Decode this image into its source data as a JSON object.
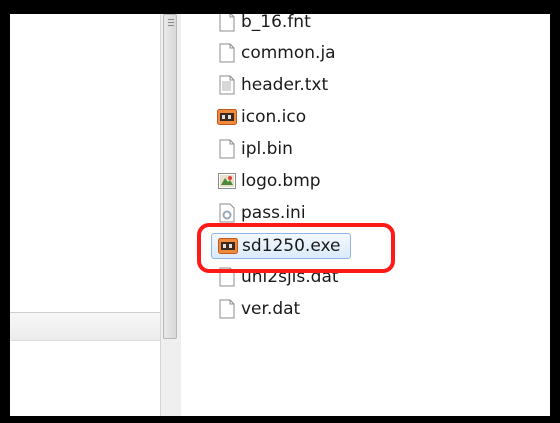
{
  "files": [
    {
      "name": "b_16.fnt",
      "icon": "file-icon"
    },
    {
      "name": "common.ja",
      "icon": "file-icon"
    },
    {
      "name": "header.txt",
      "icon": "text-file-icon"
    },
    {
      "name": "icon.ico",
      "icon": "app-icon"
    },
    {
      "name": "ipl.bin",
      "icon": "file-icon"
    },
    {
      "name": "logo.bmp",
      "icon": "bitmap-icon"
    },
    {
      "name": "pass.ini",
      "icon": "settings-file-icon"
    },
    {
      "name": "sd1250.exe",
      "icon": "app-icon",
      "selected": true
    },
    {
      "name": "uni2sjis.dat",
      "icon": "file-icon"
    },
    {
      "name": "ver.dat",
      "icon": "file-icon"
    }
  ],
  "highlight_color": "#ff1a1a",
  "selection_color": "#dbeafb"
}
